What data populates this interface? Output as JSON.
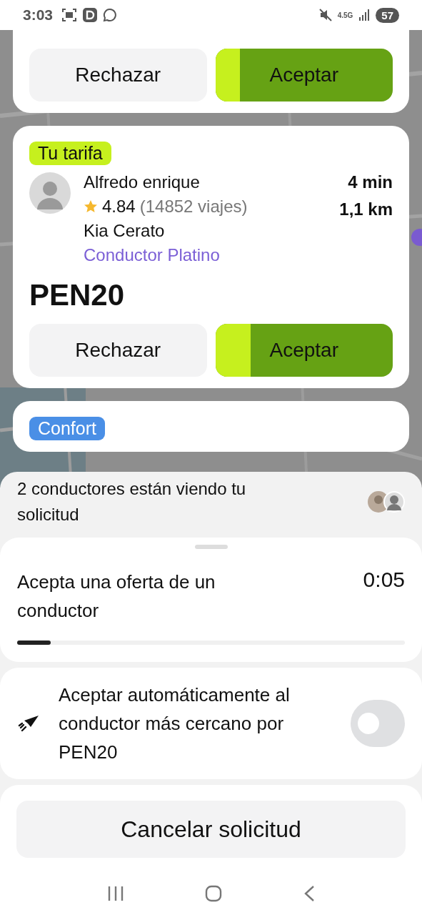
{
  "status_bar": {
    "time": "3:03",
    "network": "4.5G",
    "battery": "57"
  },
  "offers": [
    {
      "buttons": {
        "reject": "Rechazar",
        "accept": "Aceptar",
        "level": 0.14
      }
    },
    {
      "badge": {
        "label": "Tu tarifa",
        "color": "#c6f01e"
      },
      "driver": {
        "name": "Alfredo enrique",
        "rating": "4.84",
        "trips": "(14852 viajes)",
        "car": "Kia Cerato",
        "tier": "Conductor Platino"
      },
      "eta": "4 min",
      "distance": "1,1 km",
      "price": "PEN20",
      "buttons": {
        "reject": "Rechazar",
        "accept": "Aceptar",
        "level": 0.2
      }
    },
    {
      "badge": {
        "label": "Confort",
        "color": "#4a8fe6"
      }
    }
  ],
  "viewers": {
    "text": "2 conductores están viendo tu solicitud"
  },
  "waiting": {
    "title": "Acepta una oferta de un conductor",
    "timer": "0:05",
    "level": 0.086
  },
  "auto_accept": {
    "text": "Aceptar automáticamente al conductor más cercano por PEN20",
    "on": false
  },
  "cancel_button": "Cancelar solicitud"
}
